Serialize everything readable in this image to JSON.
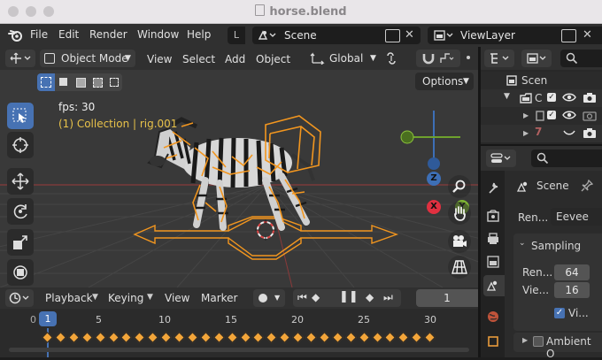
{
  "window": {
    "title": "horse.blend"
  },
  "menubar": {
    "items": [
      "File",
      "Edit",
      "Render",
      "Window",
      "Help"
    ],
    "workspace_tab": "L",
    "scene": "Scene",
    "view_layer": "ViewLayer"
  },
  "viewport_header": {
    "mode": "Object Mode",
    "menus": [
      "View",
      "Select",
      "Add",
      "Object"
    ],
    "transform_orientation": "Global",
    "options": "Options"
  },
  "viewport": {
    "fps": "fps: 30",
    "collection": "(1) Collection | rig.001",
    "gizmo": {
      "z": "Z",
      "x": "X",
      "y": "Y"
    }
  },
  "outliner": {
    "root": "Scen",
    "row1": "C"
  },
  "properties": {
    "context": "Scene",
    "render_engine_label": "Ren...",
    "render_engine_value": "Eevee",
    "sampling_title": "Sampling",
    "render_samples_label": "Ren...",
    "render_samples_value": "64",
    "viewport_samples_label": "Vie...",
    "viewport_samples_value": "16",
    "viewport_denoise_label": "Vi...",
    "ambient_title": "Ambient O"
  },
  "timeline": {
    "playback": "Playback",
    "keying": "Keying",
    "view": "View",
    "marker": "Marker",
    "current_frame": "1",
    "ruler": [
      "0",
      "1",
      "5",
      "10",
      "15",
      "20",
      "25",
      "30"
    ]
  },
  "colors": {
    "accent": "#4772b3",
    "orange": "#f2961f",
    "header": "#303030",
    "viewport": "#393939"
  }
}
